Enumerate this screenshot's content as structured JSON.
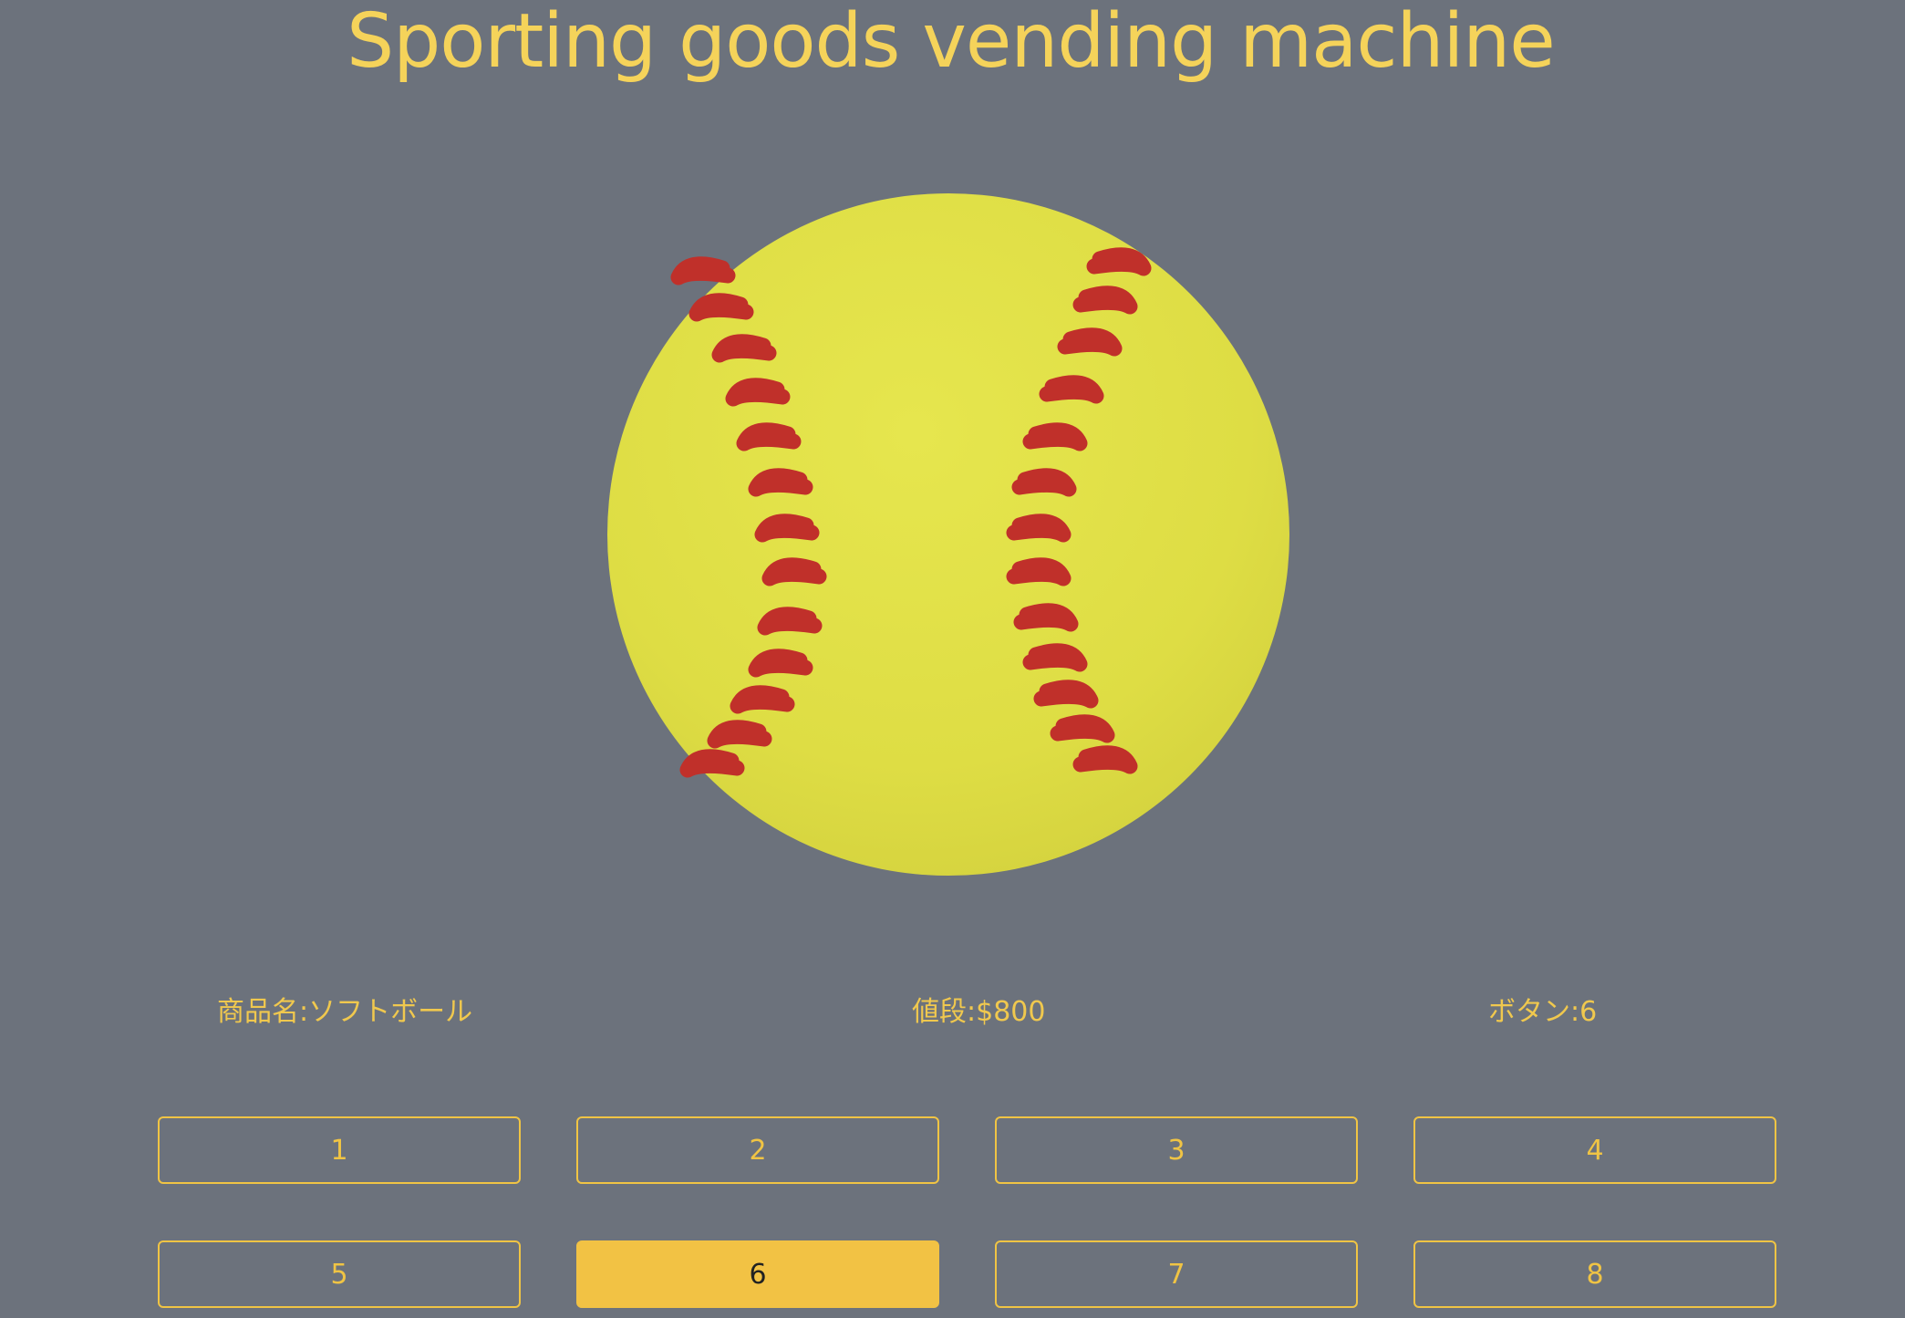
{
  "app": {
    "title": "Sporting goods vending machine"
  },
  "product": {
    "image_icon": "softball-icon",
    "name_label": "商品名:ソフトボール",
    "price_label": "値段:$800",
    "button_label": "ボタン:6"
  },
  "buttons": [
    {
      "label": "1",
      "selected": false
    },
    {
      "label": "2",
      "selected": false
    },
    {
      "label": "3",
      "selected": false
    },
    {
      "label": "4",
      "selected": false
    },
    {
      "label": "5",
      "selected": false
    },
    {
      "label": "6",
      "selected": true
    },
    {
      "label": "7",
      "selected": false
    },
    {
      "label": "8",
      "selected": false
    }
  ],
  "colors": {
    "background": "#6c727c",
    "accent": "#f2c244",
    "title": "#f5d35a",
    "ball": "#e2e048",
    "stitch": "#c0302a"
  }
}
